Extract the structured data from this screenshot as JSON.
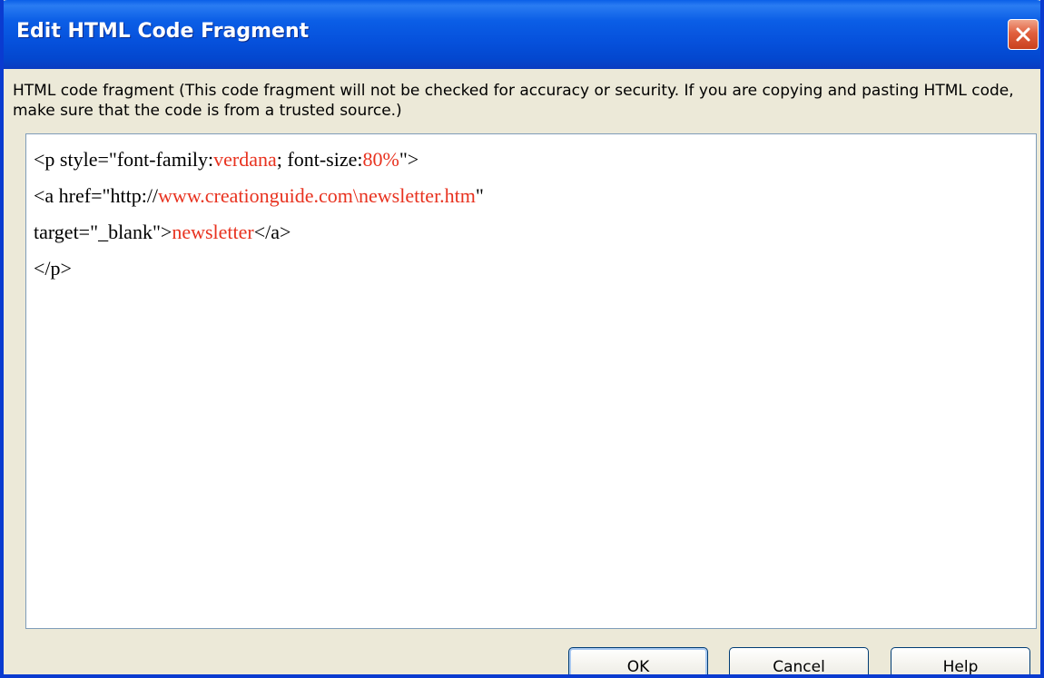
{
  "window": {
    "title": "Edit HTML Code Fragment"
  },
  "description": "HTML code fragment (This code fragment will not be checked for accuracy or security. If you are copying and pasting HTML code, make sure that the code is from a trusted source.)",
  "code": {
    "line1": {
      "a": "<p style=\"font-family:",
      "b": "verdana",
      "c": "; font-size:",
      "d": "80%",
      "e": "\">"
    },
    "line2": {
      "a": "<a href=\"http://",
      "b": "www.creationguide.com\\newsletter.htm",
      "c": "\""
    },
    "line3": {
      "a": "target=\"_blank\">",
      "b": "newsletter",
      "c": "</a>"
    },
    "line4": {
      "a": "</p>"
    },
    "highlight_color": "#e8321f"
  },
  "buttons": {
    "ok": "OK",
    "cancel": "Cancel",
    "help": "Help"
  },
  "icons": {
    "close": "close-icon"
  }
}
